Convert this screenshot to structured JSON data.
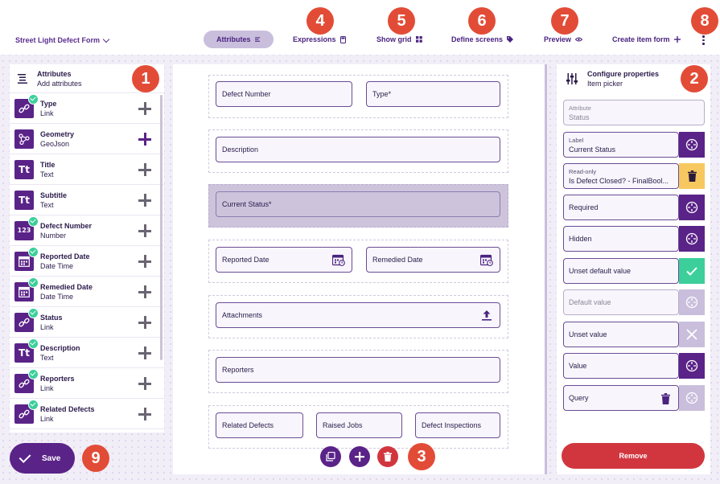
{
  "topbar": {
    "form_name": "Street Light Defect Form",
    "tabs": [
      {
        "label": "Attributes",
        "icon": "lines-icon",
        "active": true
      },
      {
        "label": "Expressions",
        "icon": "calculator-icon"
      },
      {
        "label": "Show grid",
        "icon": "grid-icon"
      },
      {
        "label": "Define screens",
        "icon": "tag-icon"
      },
      {
        "label": "Preview",
        "icon": "eye-icon"
      },
      {
        "label": "Create item form",
        "icon": "plus-icon"
      }
    ]
  },
  "badges": [
    "1",
    "2",
    "3",
    "4",
    "5",
    "6",
    "7",
    "8",
    "9"
  ],
  "left_panel": {
    "title": "Attributes",
    "subtitle": "Add attributes",
    "items": [
      {
        "name": "Type",
        "type": "Link",
        "icon": "link-icon",
        "checked": true
      },
      {
        "name": "Geometry",
        "type": "GeoJson",
        "icon": "geometry-icon",
        "checked": false
      },
      {
        "name": "Title",
        "type": "Text",
        "icon": "text-icon",
        "checked": false
      },
      {
        "name": "Subtitle",
        "type": "Text",
        "icon": "text-icon",
        "checked": false
      },
      {
        "name": "Defect Number",
        "type": "Number",
        "icon": "number-icon",
        "checked": true
      },
      {
        "name": "Reported Date",
        "type": "Date Time",
        "icon": "calendar-icon",
        "checked": true
      },
      {
        "name": "Remedied Date",
        "type": "Date Time",
        "icon": "calendar-icon",
        "checked": true
      },
      {
        "name": "Status",
        "type": "Link",
        "icon": "link-icon",
        "checked": true
      },
      {
        "name": "Description",
        "type": "Text",
        "icon": "text-icon",
        "checked": true
      },
      {
        "name": "Reporters",
        "type": "Link",
        "icon": "link-icon",
        "checked": true
      },
      {
        "name": "Related Defects",
        "type": "Link",
        "icon": "link-icon",
        "checked": true
      }
    ]
  },
  "save_label": "Save",
  "canvas": {
    "fields": {
      "defect_number": "Defect Number",
      "type": "Type*",
      "description": "Description",
      "current_status": "Current Status*",
      "reported_date": "Reported Date",
      "remedied_date": "Remedied Date",
      "attachments": "Attachments",
      "reporters": "Reporters",
      "related_defects": "Related Defects",
      "raised_jobs": "Raised Jobs",
      "defect_inspections": "Defect Inspections"
    }
  },
  "right_panel": {
    "title": "Configure properties",
    "subtitle": "Item picker",
    "attribute": {
      "label": "Attribute",
      "value": "Status"
    },
    "label_field": {
      "label": "Label",
      "value": "Current Status"
    },
    "read_only": {
      "label": "Read-only",
      "value": "Is Defect Closed? - FinalBool..."
    },
    "required": "Required",
    "hidden": "Hidden",
    "unset_default_value": "Unset default value",
    "default_value": "Default value",
    "unset_value": "Unset value",
    "value": "Value",
    "query": "Query",
    "remove_label": "Remove"
  },
  "colors": {
    "primary": "#5a2388",
    "badge": "#e24c37",
    "remove": "#d1363f",
    "success": "#3ccf9b",
    "warning": "#f6c85f"
  }
}
